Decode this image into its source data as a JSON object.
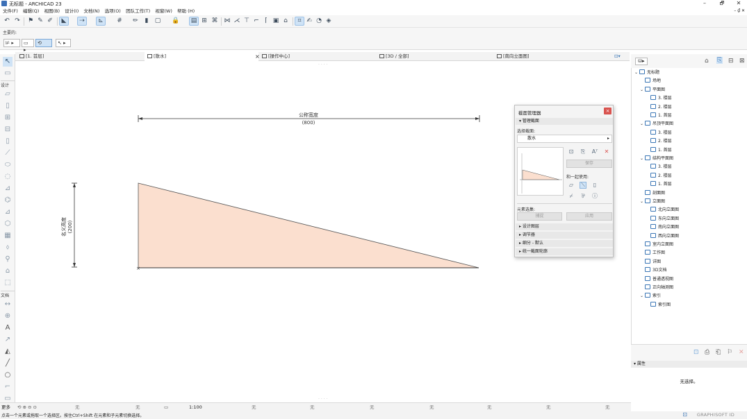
{
  "window": {
    "title": "无标题 - ARCHICAD 23",
    "minimize": "–",
    "maximize": "🗗",
    "close": "✕"
  },
  "menu": {
    "items": [
      "文件(F)",
      "编辑(Q)",
      "视图(B)",
      "设计(I)",
      "文档(N)",
      "选项(O)",
      "团队工作(T)",
      "视窗(W)",
      "帮助 (H)"
    ],
    "right_controls": "– ₫ ✕"
  },
  "info_row": {
    "label": "主要的:"
  },
  "tabs": [
    {
      "label": "[1. 首层]",
      "icon": "floor-plan-icon"
    },
    {
      "label": "[散水]",
      "icon": "section-icon",
      "active": true
    },
    {
      "label": "[操作中心]",
      "icon": "action-center-icon"
    },
    {
      "label": "[3D / 全部]",
      "icon": "3d-icon"
    },
    {
      "label": "[南向立面图]",
      "icon": "elevation-icon"
    }
  ],
  "toolbox": {
    "section_design": "设计",
    "section_document": "文档"
  },
  "canvas": {
    "width_label": "公称宽度",
    "width_value": "(800)",
    "height_label": "名义高度",
    "height_value": "(200)"
  },
  "dialog": {
    "title": "截面管理器",
    "manage_section": "管理截面",
    "select_profile": "选择截面:",
    "profile_name": "散水",
    "save": "保存",
    "use_with": "和一起使用:",
    "element_set": "元素选集:",
    "capture": "捕捉",
    "apply": "应用",
    "sections": [
      "设计图层",
      "调节器",
      "细分 - 默认",
      "统一截面轮廓"
    ]
  },
  "navigator": {
    "items": [
      {
        "label": "无标题",
        "level": 0,
        "expand": "⌄"
      },
      {
        "label": "场地",
        "level": 1,
        "expand": ""
      },
      {
        "label": "平面图",
        "level": 1,
        "expand": "⌄"
      },
      {
        "label": "3. 楼层",
        "level": 2,
        "expand": ""
      },
      {
        "label": "2. 楼层",
        "level": 2,
        "expand": ""
      },
      {
        "label": "1. 首层",
        "level": 2,
        "expand": ""
      },
      {
        "label": "吊顶平面图",
        "level": 1,
        "expand": "⌄"
      },
      {
        "label": "3. 楼层",
        "level": 2,
        "expand": ""
      },
      {
        "label": "2. 楼层",
        "level": 2,
        "expand": ""
      },
      {
        "label": "1. 首层",
        "level": 2,
        "expand": ""
      },
      {
        "label": "结构平面图",
        "level": 1,
        "expand": "⌄"
      },
      {
        "label": "3. 楼层",
        "level": 2,
        "expand": ""
      },
      {
        "label": "2. 楼层",
        "level": 2,
        "expand": ""
      },
      {
        "label": "1. 首层",
        "level": 2,
        "expand": ""
      },
      {
        "label": "剖面图",
        "level": 1,
        "expand": ""
      },
      {
        "label": "立面图",
        "level": 1,
        "expand": "⌄"
      },
      {
        "label": "北向立面图",
        "level": 2,
        "expand": ""
      },
      {
        "label": "东向立面图",
        "level": 2,
        "expand": ""
      },
      {
        "label": "南向立面图",
        "level": 2,
        "expand": ""
      },
      {
        "label": "西向立面图",
        "level": 2,
        "expand": ""
      },
      {
        "label": "室内立面图",
        "level": 1,
        "expand": ""
      },
      {
        "label": "工作图",
        "level": 1,
        "expand": ""
      },
      {
        "label": "详图",
        "level": 1,
        "expand": ""
      },
      {
        "label": "3D文档",
        "level": 1,
        "expand": ""
      },
      {
        "label": "普通透视图",
        "level": 1,
        "expand": ""
      },
      {
        "label": "正向轴测图",
        "level": 1,
        "expand": ""
      },
      {
        "label": "索引",
        "level": 1,
        "expand": "⌄"
      },
      {
        "label": "索引图",
        "level": 2,
        "expand": ""
      }
    ]
  },
  "properties": {
    "header": "属性",
    "value": "无选择。"
  },
  "quickbar": {
    "more": "更多",
    "scale": "1:100",
    "none": "无"
  },
  "status": {
    "message": "点击一个元素或拖取一个选择区。按住Ctrl+Shift 在元素和子元素切换选择。",
    "brand": "GRAPHISOFT ID"
  },
  "colors": {
    "profile_fill": "#fbdfcf",
    "accent": "#3b76b5",
    "selected_bg": "#cfe3f6",
    "close_red": "#d9534f"
  }
}
